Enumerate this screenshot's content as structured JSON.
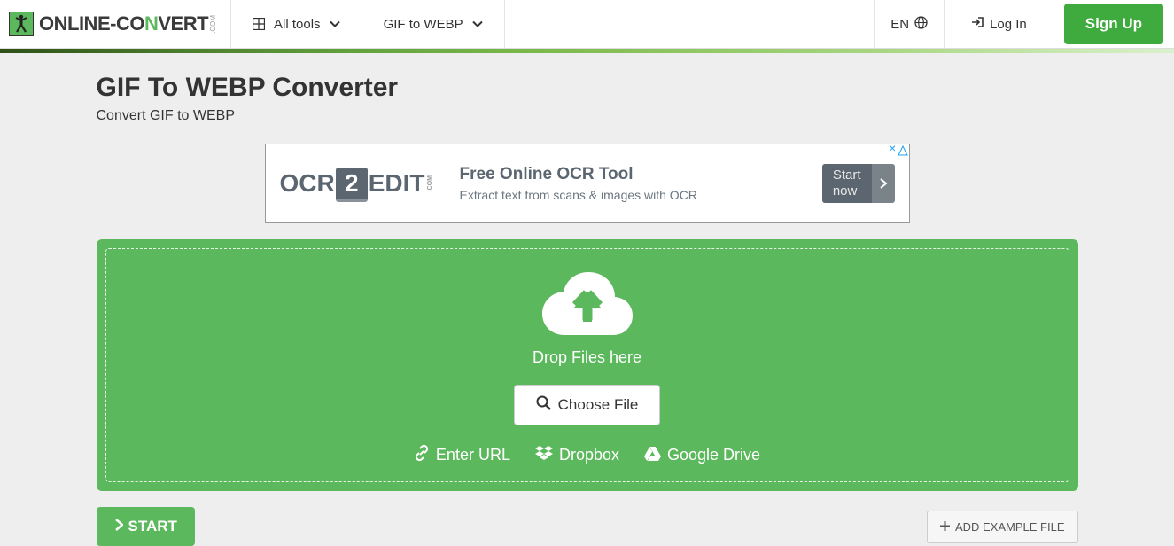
{
  "header": {
    "logo": {
      "part1": "ONLINE-",
      "part2": "CO",
      "part3": "N",
      "part4": "VERT",
      "suffix": ".COM"
    },
    "nav": {
      "all_tools": "All tools",
      "converter": "GIF to WEBP"
    },
    "lang": "EN",
    "login": "Log In",
    "signup": "Sign Up"
  },
  "page": {
    "title": "GIF To WEBP Converter",
    "subtitle": "Convert GIF to WEBP"
  },
  "ad": {
    "logo_1": "OCR",
    "logo_2": "2",
    "logo_3": "EDIT",
    "logo_suffix": ".COM",
    "title": "Free Online OCR Tool",
    "desc": "Extract text from scans & images with OCR",
    "cta_line1": "Start",
    "cta_line2": "now"
  },
  "dropzone": {
    "drop_text": "Drop Files here",
    "choose": "Choose File",
    "url": "Enter URL",
    "dropbox": "Dropbox",
    "gdrive": "Google Drive"
  },
  "actions": {
    "start": "START",
    "example": "ADD EXAMPLE FILE"
  }
}
